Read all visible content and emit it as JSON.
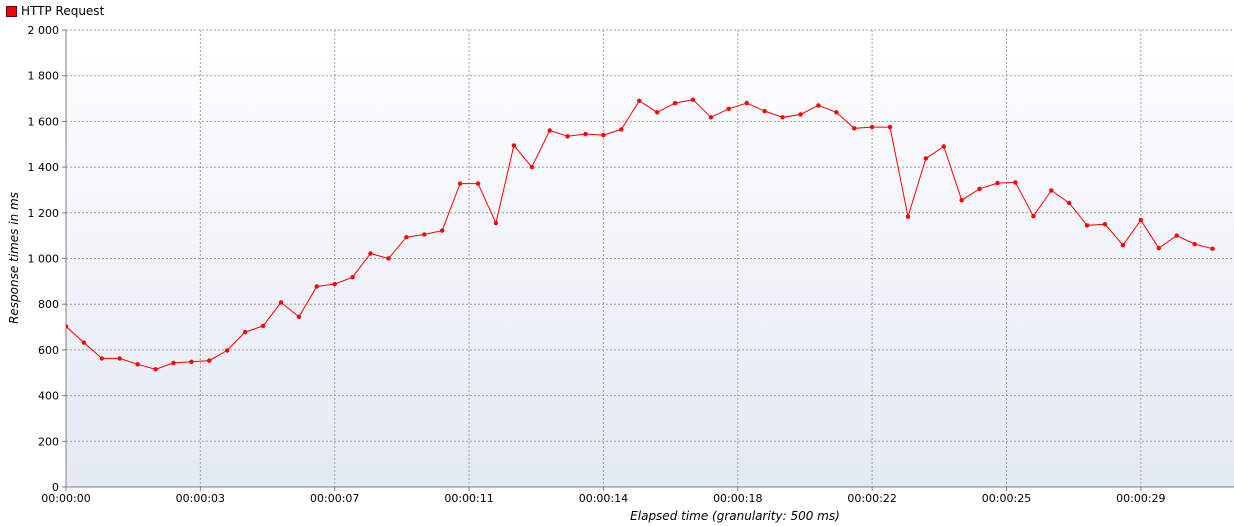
{
  "legend": {
    "label": "HTTP Request",
    "color": "#ff0000"
  },
  "chart_data": {
    "type": "line",
    "title": "",
    "xlabel": "Elapsed time (granularity: 500 ms)",
    "ylabel": "Response times in ms",
    "ylim": [
      0,
      2000
    ],
    "yticks": [
      "0",
      "200",
      "400",
      "600",
      "800",
      "1 000",
      "1 200",
      "1 400",
      "1 600",
      "1 800",
      "2 000"
    ],
    "xtick_labels": [
      "00:00:00",
      "00:00:03",
      "00:00:07",
      "00:00:11",
      "00:00:14",
      "00:00:18",
      "00:00:22",
      "00:00:25",
      "00:00:29"
    ],
    "granularity_ms": 500,
    "grid": true,
    "legend_position": "top-left",
    "series": [
      {
        "name": "HTTP Request",
        "color": "#ff0000",
        "x_seconds": [
          0,
          0.5,
          1,
          1.5,
          2,
          2.5,
          3,
          3.5,
          4,
          4.5,
          5,
          5.5,
          6,
          6.5,
          7,
          7.5,
          8,
          8.5,
          9,
          9.5,
          10,
          10.5,
          11,
          11.5,
          12,
          12.5,
          13,
          13.5,
          14,
          14.5,
          15,
          15.5,
          16,
          16.5,
          17,
          17.5,
          18,
          18.5,
          19,
          19.5,
          20,
          20.5,
          21,
          21.5,
          22,
          22.5,
          23,
          23.5,
          24,
          24.5,
          25,
          25.5,
          26,
          26.5,
          27,
          27.5,
          28,
          28.5,
          29,
          29.5,
          30,
          30.5,
          31,
          31.5,
          32
        ],
        "values": [
          703,
          632,
          563,
          563,
          537,
          515,
          543,
          548,
          553,
          598,
          678,
          705,
          808,
          745,
          878,
          888,
          918,
          1022,
          1000,
          1093,
          1105,
          1122,
          1328,
          1328,
          1155,
          1495,
          1400,
          1560,
          1535,
          1545,
          1540,
          1565,
          1690,
          1640,
          1680,
          1695,
          1618,
          1655,
          1680,
          1645,
          1618,
          1630,
          1670,
          1640,
          1570,
          1575,
          1575,
          1183,
          1438,
          1490,
          1255,
          1305,
          1330,
          1333,
          1185,
          1298,
          1243,
          1145,
          1150,
          1058,
          1168,
          1045,
          1100,
          1063,
          1043
        ]
      }
    ]
  }
}
